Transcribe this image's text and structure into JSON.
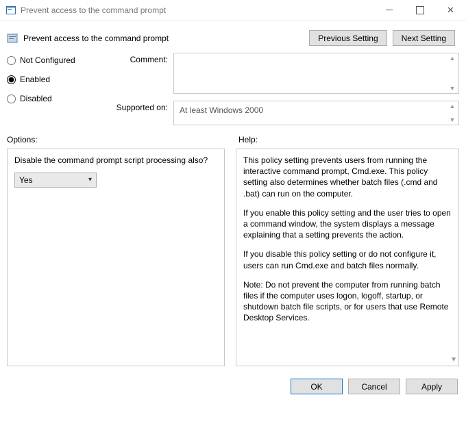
{
  "window": {
    "title": "Prevent access to the command prompt"
  },
  "header": {
    "policy_title": "Prevent access to the command prompt",
    "prev_btn": "Previous Setting",
    "next_btn": "Next Setting"
  },
  "state": {
    "not_configured": "Not Configured",
    "enabled": "Enabled",
    "disabled": "Disabled",
    "selected": "enabled"
  },
  "fields": {
    "comment_label": "Comment:",
    "comment_value": "",
    "supported_label": "Supported on:",
    "supported_value": "At least Windows 2000"
  },
  "sections": {
    "options_label": "Options:",
    "help_label": "Help:"
  },
  "options": {
    "question": "Disable the command prompt script processing also?",
    "selected_value": "Yes"
  },
  "help": {
    "p1": "This policy setting prevents users from running the interactive command prompt, Cmd.exe.  This policy setting also determines whether batch files (.cmd and .bat) can run on the computer.",
    "p2": "If you enable this policy setting and the user tries to open a command window, the system displays a message explaining that a setting prevents the action.",
    "p3": "If you disable this policy setting or do not configure it, users can run Cmd.exe and batch files normally.",
    "p4": "Note: Do not prevent the computer from running batch files if the computer uses logon, logoff, startup, or shutdown batch file scripts, or for users that use Remote Desktop Services."
  },
  "footer": {
    "ok": "OK",
    "cancel": "Cancel",
    "apply": "Apply"
  }
}
